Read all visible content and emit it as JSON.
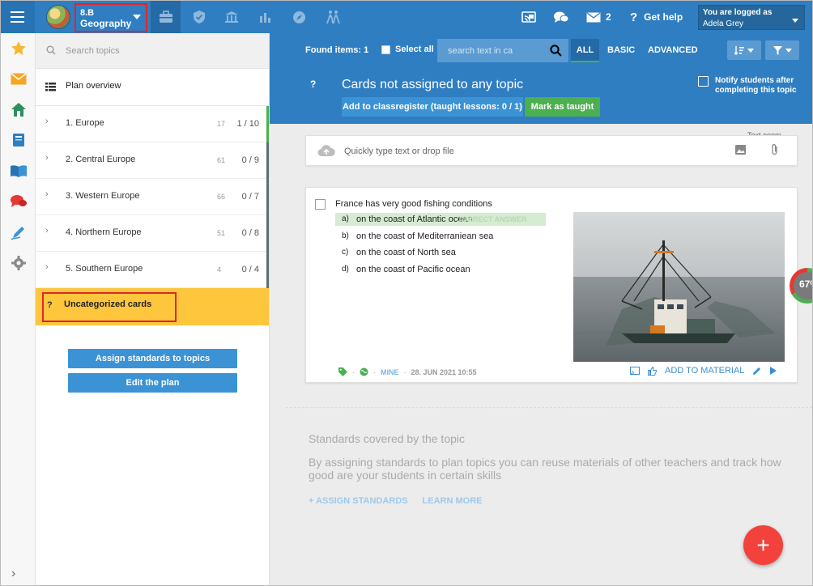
{
  "topbar": {
    "class_code": "8.B",
    "class_subject": "Geography",
    "messages_count": "2",
    "get_help_label": "Get help",
    "logged_as_label": "You are logged as",
    "user_name": "Adela Grey"
  },
  "topics_panel": {
    "search_placeholder": "Search topics",
    "plan_overview_label": "Plan overview",
    "topics": [
      {
        "name": "1. Europe",
        "count": "17",
        "progress": "1 / 10"
      },
      {
        "name": "2. Central Europe",
        "count": "61",
        "progress": "0 / 9"
      },
      {
        "name": "3. Western Europe",
        "count": "66",
        "progress": "0 / 7"
      },
      {
        "name": "4. Northern Europe",
        "count": "51",
        "progress": "0 / 8"
      },
      {
        "name": "5. Southern Europe",
        "count": "4",
        "progress": "0 / 4"
      }
    ],
    "uncategorized_icon": "?",
    "uncategorized_label": "Uncategorized cards",
    "assign_standards_button": "Assign standards to topics",
    "edit_plan_button": "Edit the plan"
  },
  "main": {
    "found_items": "Found items: 1",
    "select_all_label": "Select all",
    "search_placeholder": "search text in ca",
    "filter_all": "ALL",
    "filter_basic": "BASIC",
    "filter_advanced": "ADVANCED",
    "question_icon": "?",
    "section_title": "Cards not assigned to any topic",
    "add_to_classregister_button": "Add to classregister (taught lessons: 0 / 1)",
    "mark_as_taught_button": "Mark as taught",
    "notify_label": "Notify students after completing this topic",
    "text_peek": "Text  ooom",
    "quick_placeholder": "Quickly type text or drop file"
  },
  "card": {
    "question": "France has very good fishing conditions",
    "answers": [
      {
        "letter": "a)",
        "text": "on the coast of Atlantic ocean",
        "correct": true
      },
      {
        "letter": "b)",
        "text": "on the coast of Mediterraniean sea",
        "correct": false
      },
      {
        "letter": "c)",
        "text": "on the coast of North sea",
        "correct": false
      },
      {
        "letter": "d)",
        "text": "on the coast of Pacific ocean",
        "correct": false
      }
    ],
    "correct_answer_label": "CORRECT ANSWER",
    "meta_separator": "·",
    "meta_owner": "MINE",
    "meta_date": "28. JUN 2021 10:55",
    "add_to_material_label": "ADD TO MATERIAL"
  },
  "standards": {
    "title": "Standards covered by the topic",
    "description": "By assigning standards to plan topics you can reuse materials of other teachers and track how good are your students in certain skills",
    "assign_link": "+ ASSIGN STANDARDS",
    "learn_more_link": "LEARN MORE"
  },
  "gauge": {
    "percent_label": "67%",
    "value": 67
  },
  "fab_label": "+",
  "colors": {
    "primary": "#2f7ec1",
    "highlight": "#fdc63d",
    "success": "#4caf50",
    "danger": "#f3413b"
  }
}
